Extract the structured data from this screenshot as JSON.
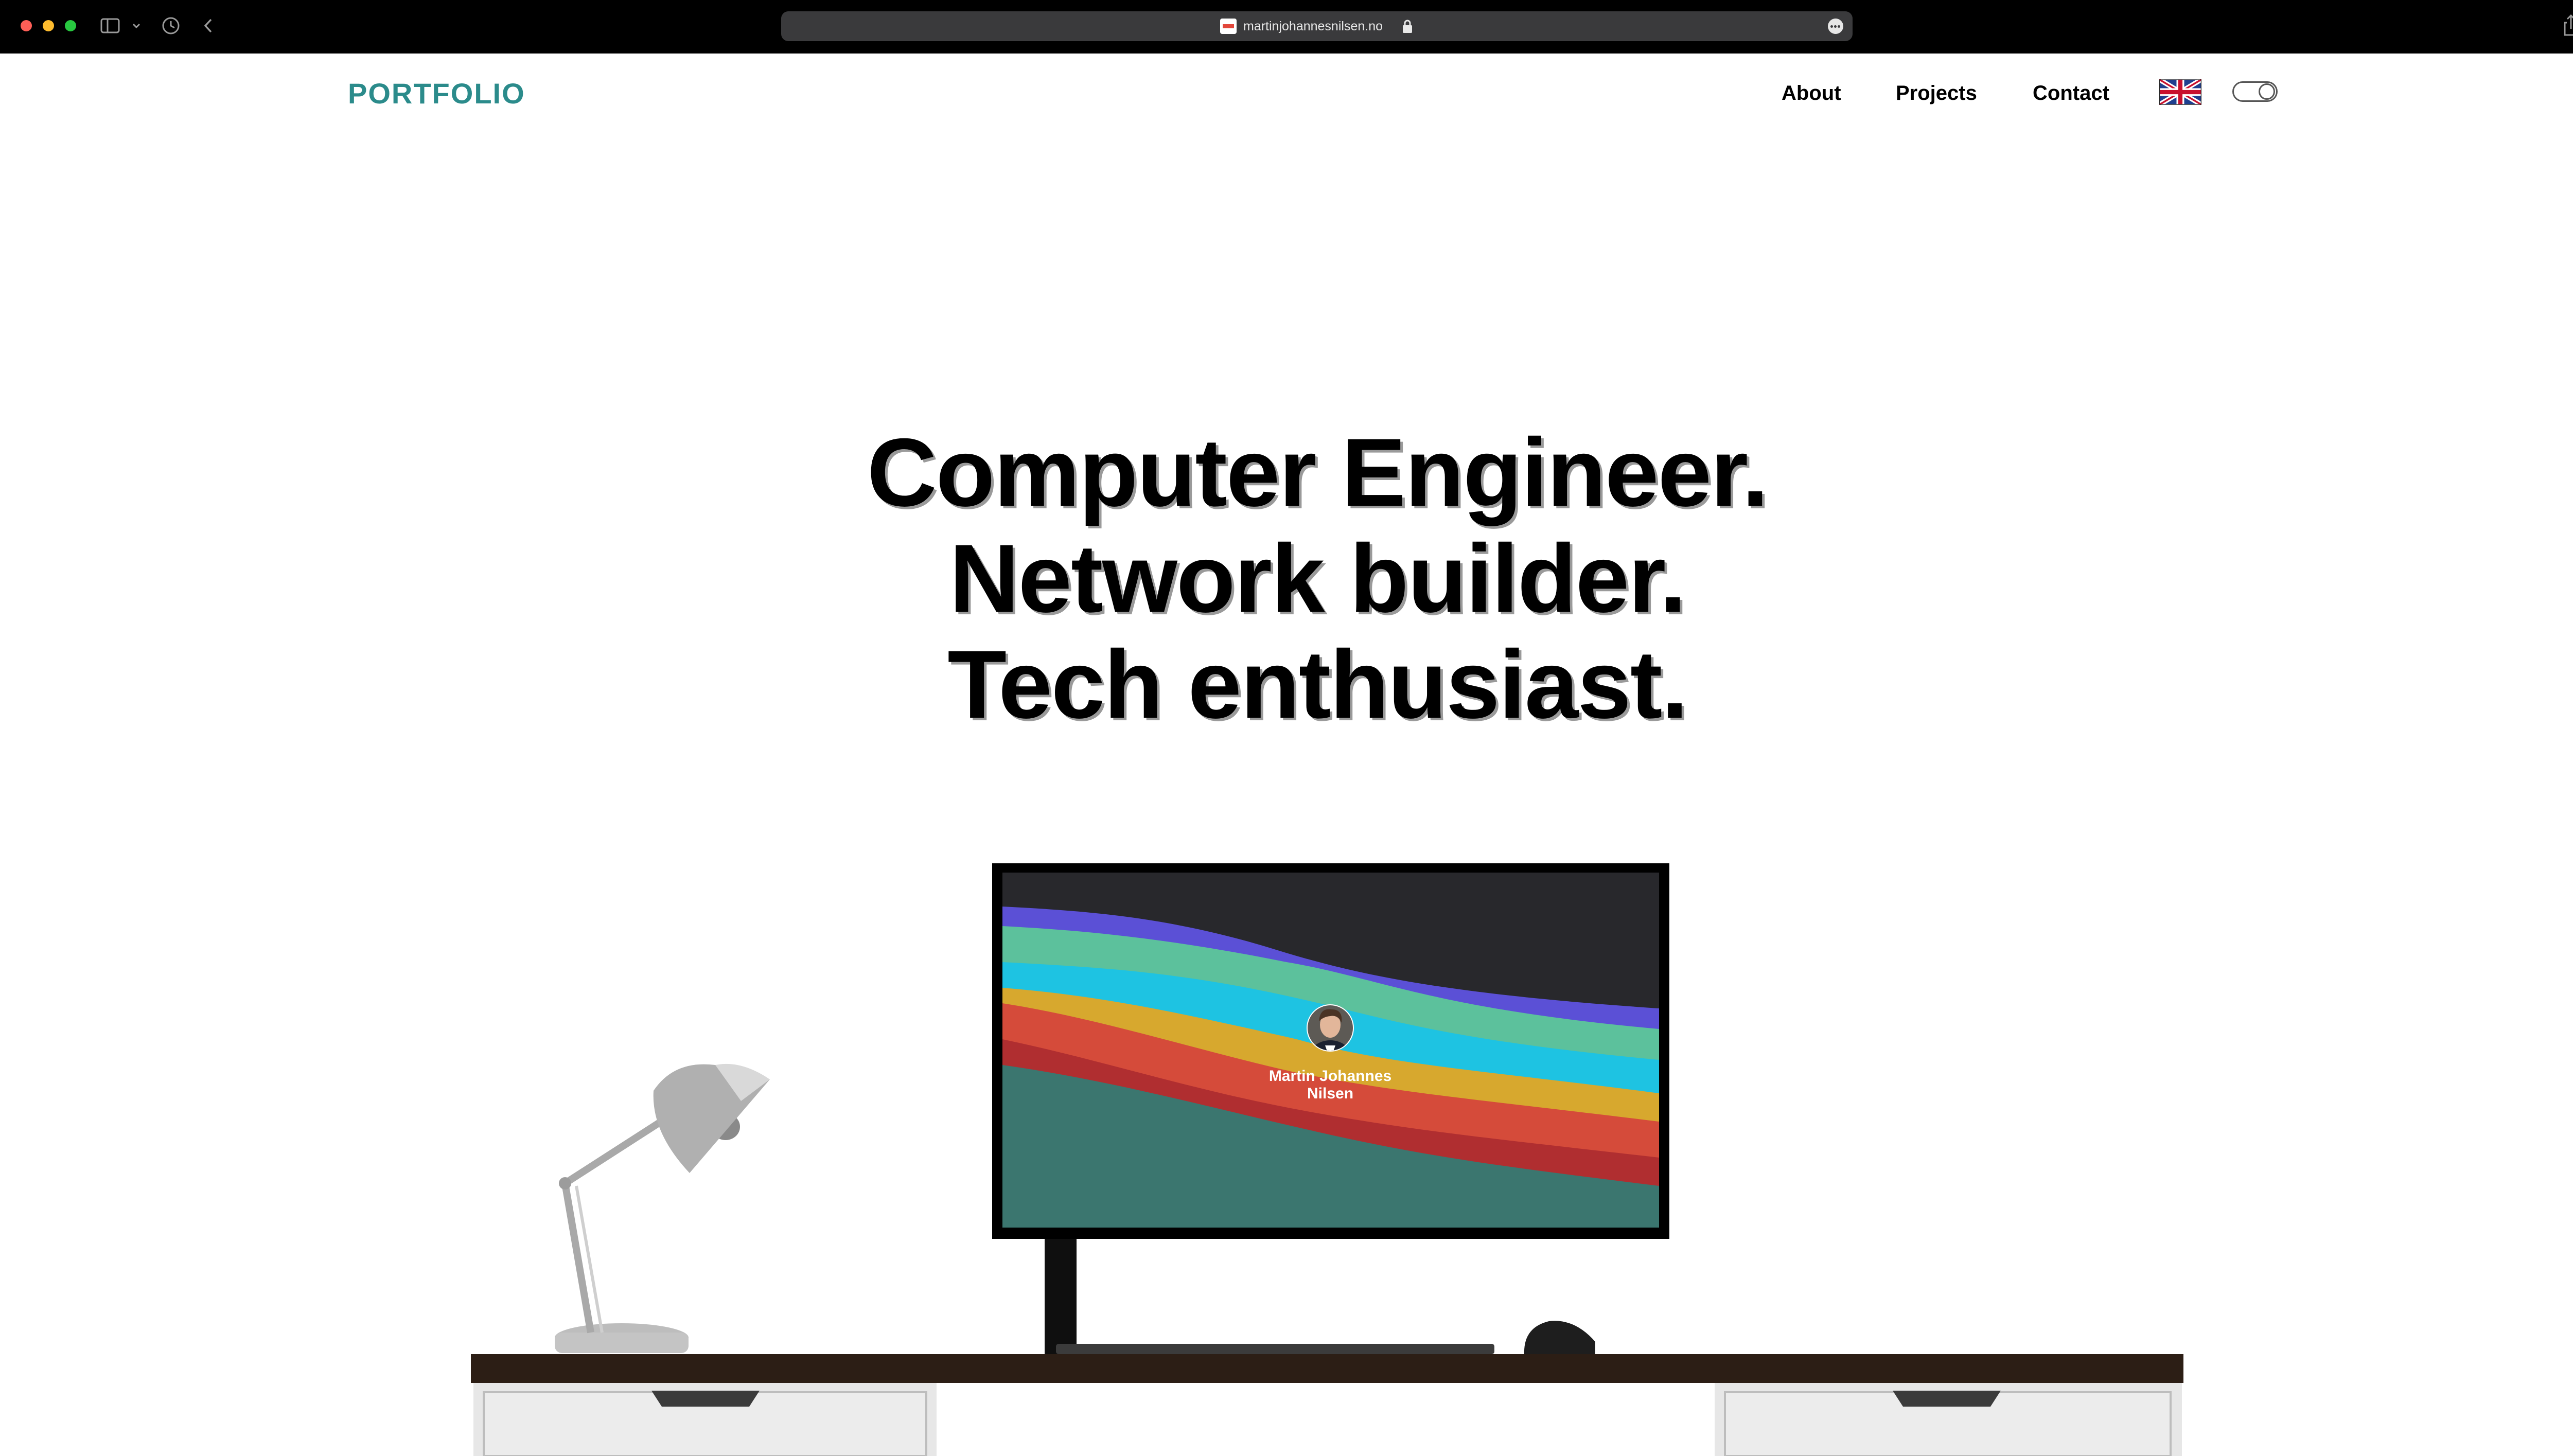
{
  "browser": {
    "url": "martinjohannesnilsen.no",
    "icons": [
      "sidebar-icon",
      "chevron-down-icon",
      "history-icon",
      "back-icon",
      "lock-icon",
      "more-icon",
      "share-icon",
      "plus-icon"
    ]
  },
  "nav": {
    "logo": "PORTFOLIO",
    "links": [
      "About",
      "Projects",
      "Contact"
    ],
    "language_flag": "uk-flag-icon",
    "theme_toggle": "dark-mode-toggle"
  },
  "hero": {
    "lines": [
      "Computer Engineer.",
      "Network builder.",
      "Tech enthusiast."
    ]
  },
  "monitor": {
    "name_line1": "Martin Johannes",
    "name_line2": "Nilsen"
  },
  "colors": {
    "brand": "#2b8b8b",
    "wave_purple": "#5b50d6",
    "wave_green": "#5cc19c",
    "wave_cyan": "#1ec3e2",
    "wave_yellow": "#d7a82e",
    "wave_orange": "#d54b3a",
    "wave_red": "#b02e30",
    "wave_teal": "#3b766f",
    "desk": "#2c1e15"
  }
}
